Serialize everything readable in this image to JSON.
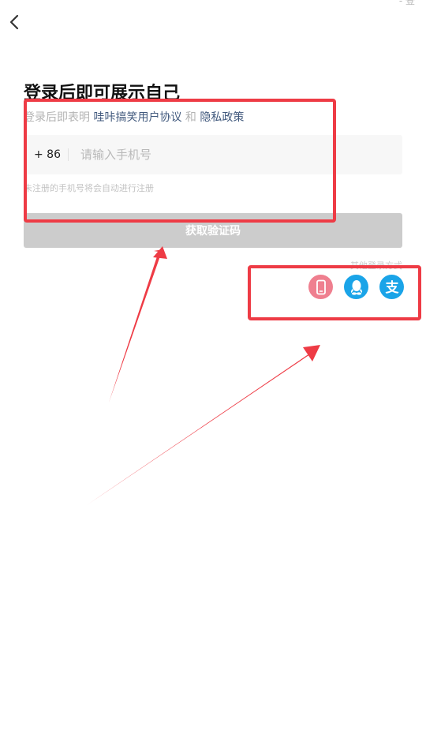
{
  "header": {
    "back_icon": "chevron-left-icon",
    "top_right_text": "- 登"
  },
  "title": "登录后即可展示自己",
  "agreement": {
    "prefix": "登录后即表明",
    "user_agreement": "哇咔搞笑用户协议",
    "conjunction": "和",
    "privacy_policy": "隐私政策"
  },
  "phone_input": {
    "country_code": "+ 86",
    "placeholder": "请输入手机号",
    "value": ""
  },
  "hint": "未注册的手机号将会自动进行注册",
  "get_code_button": {
    "label": "获取验证码"
  },
  "other_login": {
    "label": "其他登录方式",
    "options": [
      {
        "name": "phone-login",
        "icon": "mobile-phone-icon",
        "color": "#ef7f8f"
      },
      {
        "name": "qq-login",
        "icon": "qq-penguin-icon",
        "color": "#1aa4e8"
      },
      {
        "name": "alipay-login",
        "icon": "alipay-icon",
        "color": "#1aa4e8",
        "glyph": "支"
      }
    ]
  },
  "annotation_color": "#ee3b45"
}
